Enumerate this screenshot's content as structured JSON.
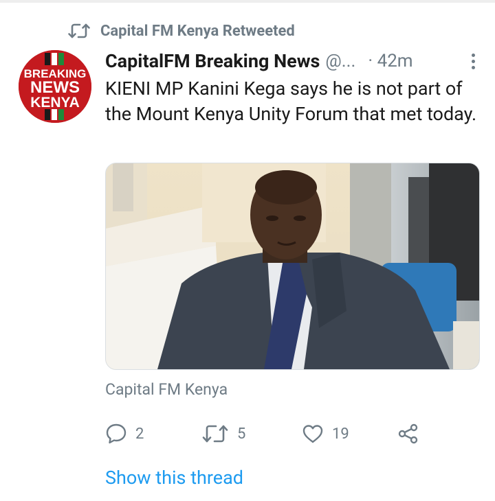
{
  "social_context": {
    "retweeted_by": "Capital FM Kenya Retweeted",
    "icon": "retweet-icon"
  },
  "tweet": {
    "avatar": {
      "line1": "BREAKING",
      "line2": "NEWS",
      "line3": "KENYA",
      "color": "#c41a1f"
    },
    "display_name": "CapitalFM Breaking News",
    "handle": "@...",
    "time": "· 42m",
    "text": "KIENI MP Kanini Kega says he is not part of the Mount Kenya Unity Forum that met today.",
    "media_source": "Capital FM Kenya",
    "actions": {
      "reply": {
        "icon": "reply-icon",
        "count": "2"
      },
      "retweet": {
        "icon": "retweet-icon",
        "count": "5"
      },
      "like": {
        "icon": "heart-icon",
        "count": "19"
      },
      "share": {
        "icon": "share-icon"
      }
    },
    "show_thread": "Show this thread"
  },
  "colors": {
    "link": "#1d9bf0",
    "secondary_text": "#6e7b85",
    "primary_text": "#1a1a1a"
  }
}
